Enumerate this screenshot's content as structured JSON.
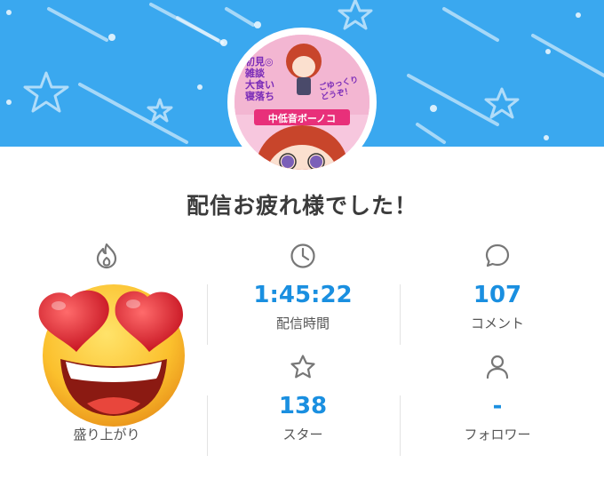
{
  "header": {
    "banner_color": "#3aa8ef",
    "avatar_icon": "streamer-avatar"
  },
  "avatar_art": {
    "left_lines": [
      "初見◎",
      "雑談",
      "大食い",
      "寝落ち"
    ],
    "right_lines": [
      "ごゆっくり",
      "どうぞ！"
    ],
    "name": "中低音ボーノコ"
  },
  "title": "配信お疲れ様でした！",
  "reaction": {
    "icon": "fire-icon",
    "emoji": "heart-eyes-emoji",
    "label": "盛り上がり"
  },
  "stats": {
    "duration": {
      "icon": "clock-icon",
      "value": "1:45:22",
      "label": "配信時間"
    },
    "comments": {
      "icon": "speech-bubble-icon",
      "value": "107",
      "label": "コメント"
    },
    "stars": {
      "icon": "star-icon",
      "value": "138",
      "label": "スター"
    },
    "followers": {
      "icon": "person-icon",
      "value": "-",
      "label": "フォロワー"
    }
  },
  "accent_color": "#1a8fe0"
}
